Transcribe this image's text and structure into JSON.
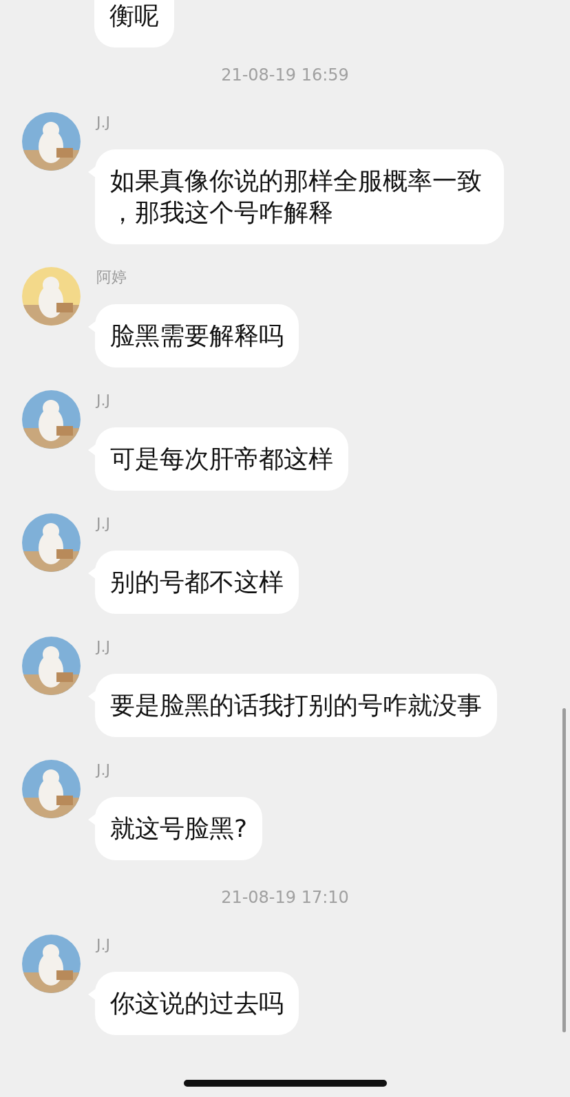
{
  "messages": [
    {
      "kind": "partial",
      "text": "衡呢"
    },
    {
      "kind": "time",
      "text": "21-08-19 16:59"
    },
    {
      "kind": "message",
      "sender": "J.J",
      "color": "#7fb0d8",
      "text": "如果真像你说的那样全服概率一致，那我这个号咋解释"
    },
    {
      "kind": "message",
      "sender": "阿婷",
      "color": "#f3d98a",
      "text": "脸黑需要解释吗"
    },
    {
      "kind": "message",
      "sender": "J.J",
      "color": "#7fb0d8",
      "text": "可是每次肝帝都这样"
    },
    {
      "kind": "message",
      "sender": "J.J",
      "color": "#7fb0d8",
      "text": "别的号都不这样"
    },
    {
      "kind": "message",
      "sender": "J.J",
      "color": "#7fb0d8",
      "text": "要是脸黑的话我打别的号咋就没事"
    },
    {
      "kind": "message",
      "sender": "J.J",
      "color": "#7fb0d8",
      "text": "就这号脸黑?"
    },
    {
      "kind": "time",
      "text": "21-08-19 17:10"
    },
    {
      "kind": "message",
      "sender": "J.J",
      "color": "#7fb0d8",
      "text": "你这说的过去吗"
    }
  ]
}
